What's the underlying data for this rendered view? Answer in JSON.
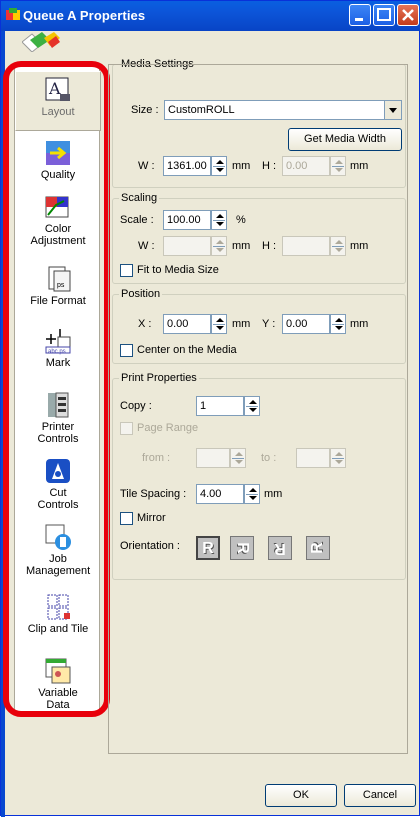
{
  "window": {
    "title": "Queue A Properties"
  },
  "sidebar": {
    "items": [
      {
        "label": "Layout",
        "icon": "layout-icon"
      },
      {
        "label": "Quality",
        "icon": "quality-icon"
      },
      {
        "label": "Color Adjustment",
        "icon": "color-adjustment-icon"
      },
      {
        "label": "File Format",
        "icon": "file-format-icon"
      },
      {
        "label": "Mark",
        "icon": "mark-icon"
      },
      {
        "label": "Printer Controls",
        "icon": "printer-controls-icon"
      },
      {
        "label": "Cut Controls",
        "icon": "cut-controls-icon"
      },
      {
        "label": "Job Management",
        "icon": "job-management-icon"
      },
      {
        "label": "Clip and Tile",
        "icon": "clip-and-tile-icon"
      },
      {
        "label": "Variable Data",
        "icon": "variable-data-icon"
      }
    ]
  },
  "media": {
    "title": "Media Settings",
    "size_label": "Size :",
    "size_value": "CustomROLL",
    "get_width_label": "Get Media Width",
    "w_label": "W :",
    "w_value": "1361.00",
    "w_unit": "mm",
    "h_label": "H :",
    "h_value": "0.00",
    "h_unit": "mm"
  },
  "scaling": {
    "title": "Scaling",
    "scale_label": "Scale :",
    "scale_value": "100.00",
    "scale_unit": "%",
    "w_label": "W :",
    "w_value": "",
    "w_unit": "mm",
    "h_label": "H :",
    "h_value": "",
    "h_unit": "mm",
    "fit_label": "Fit to Media Size"
  },
  "position": {
    "title": "Position",
    "x_label": "X :",
    "x_value": "0.00",
    "x_unit": "mm",
    "y_label": "Y :",
    "y_value": "0.00",
    "y_unit": "mm",
    "center_label": "Center on the Media"
  },
  "print": {
    "title": "Print Properties",
    "copy_label": "Copy :",
    "copy_value": "1",
    "page_range_label": "Page Range",
    "from_label": "from :",
    "to_label": "to :",
    "tile_label": "Tile Spacing :",
    "tile_value": "4.00",
    "tile_unit": "mm",
    "mirror_label": "Mirror",
    "orientation_label": "Orientation :",
    "orientation_glyphs": [
      "R",
      "R",
      "R",
      "R"
    ]
  },
  "footer": {
    "ok_label": "OK",
    "cancel_label": "Cancel"
  },
  "colors": {
    "highlight": "#e8000b",
    "titlebar": "#0a5fe0"
  }
}
